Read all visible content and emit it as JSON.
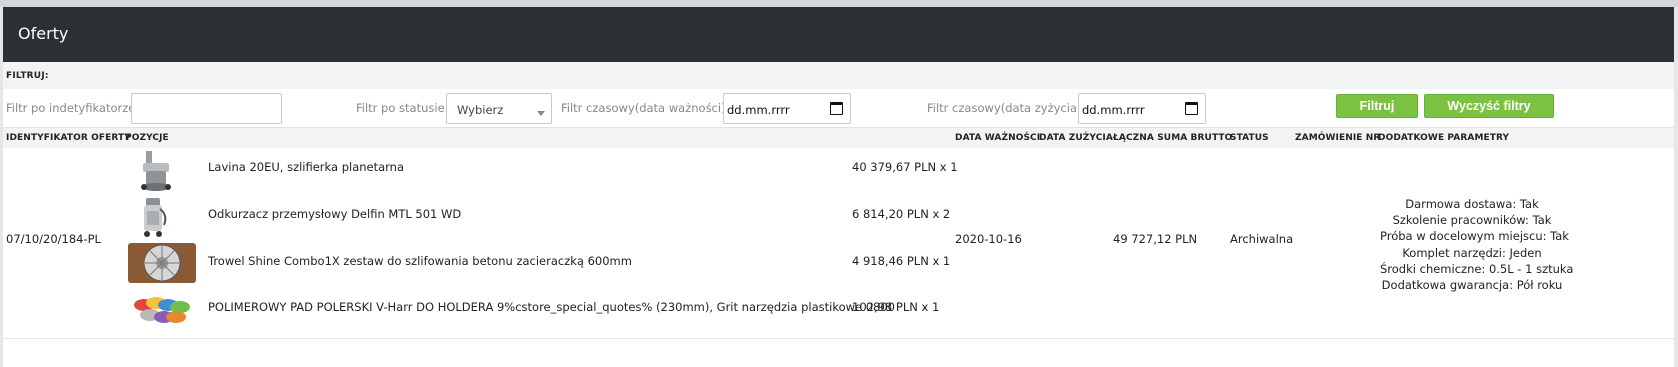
{
  "page": {
    "title": "Oferty"
  },
  "filters": {
    "heading": "FILTRUJ:",
    "identifier_label": "Filtr po indetyfikatorze:",
    "identifier_value": "",
    "status_label": "Filtr po statusie:",
    "status_selected": "Wybierz",
    "validity_label": "Filtr czasowy(data ważności):",
    "validity_value": "dd.mm.rrrr",
    "usage_label": "Filtr czasowy(data zyżycia):",
    "usage_value": "dd.mm.rrrr",
    "filter_button": "Filtruj",
    "clear_button": "Wyczyść filtry"
  },
  "table": {
    "headers": {
      "id": "IDENTYFIKATOR OFERTY",
      "positions": "POZYCJE",
      "validity": "DATA WAŻNOŚCI",
      "usage": "DATA ZUŻYCIA",
      "total": "ŁĄCZNA SUMA BRUTTO",
      "status": "STATUS",
      "order": "ZAMÓWIENIE NR",
      "params": "DODATKOWE PARAMETRY"
    },
    "rows": [
      {
        "id": "07/10/20/184-PL",
        "validity": "2020-10-16",
        "usage": "",
        "total": "49 727,12 PLN",
        "status": "Archiwalna",
        "order": "",
        "positions": [
          {
            "name": "Lavina 20EU, szlifierka planetarna",
            "price": "40 379,67 PLN x 1",
            "icon": "grinder-thumbnail"
          },
          {
            "name": "Odkurzacz przemysłowy Delfin MTL 501 WD",
            "price": "6 814,20 PLN x 2",
            "icon": "vacuum-thumbnail"
          },
          {
            "name": "Trowel Shine Combo1X zestaw do szlifowania betonu zacieraczką 600mm",
            "price": "4 918,46 PLN x 1",
            "icon": "trowel-disc-thumbnail"
          },
          {
            "name": "POLIMEROWY PAD POLERSKI V-Harr DO HOLDERA 9%cstore_special_quotes% (230mm), Grit narzędzia plastikowe 0800",
            "price": "102,98 PLN x 1",
            "icon": "polishing-pads-thumbnail"
          }
        ],
        "params": [
          "Darmowa dostawa: Tak",
          "Szkolenie pracowników: Tak",
          "Próba w docelowym miejscu: Tak",
          "Komplet narzędzi: Jeden",
          "Środki chemiczne: 0.5L - 1 sztuka",
          "Dodatkowa gwarancja: Pół roku"
        ]
      }
    ]
  },
  "colors": {
    "header_bg": "#2c3135",
    "button_green": "#7cc242",
    "row_header_bg": "#f2f3f4"
  }
}
